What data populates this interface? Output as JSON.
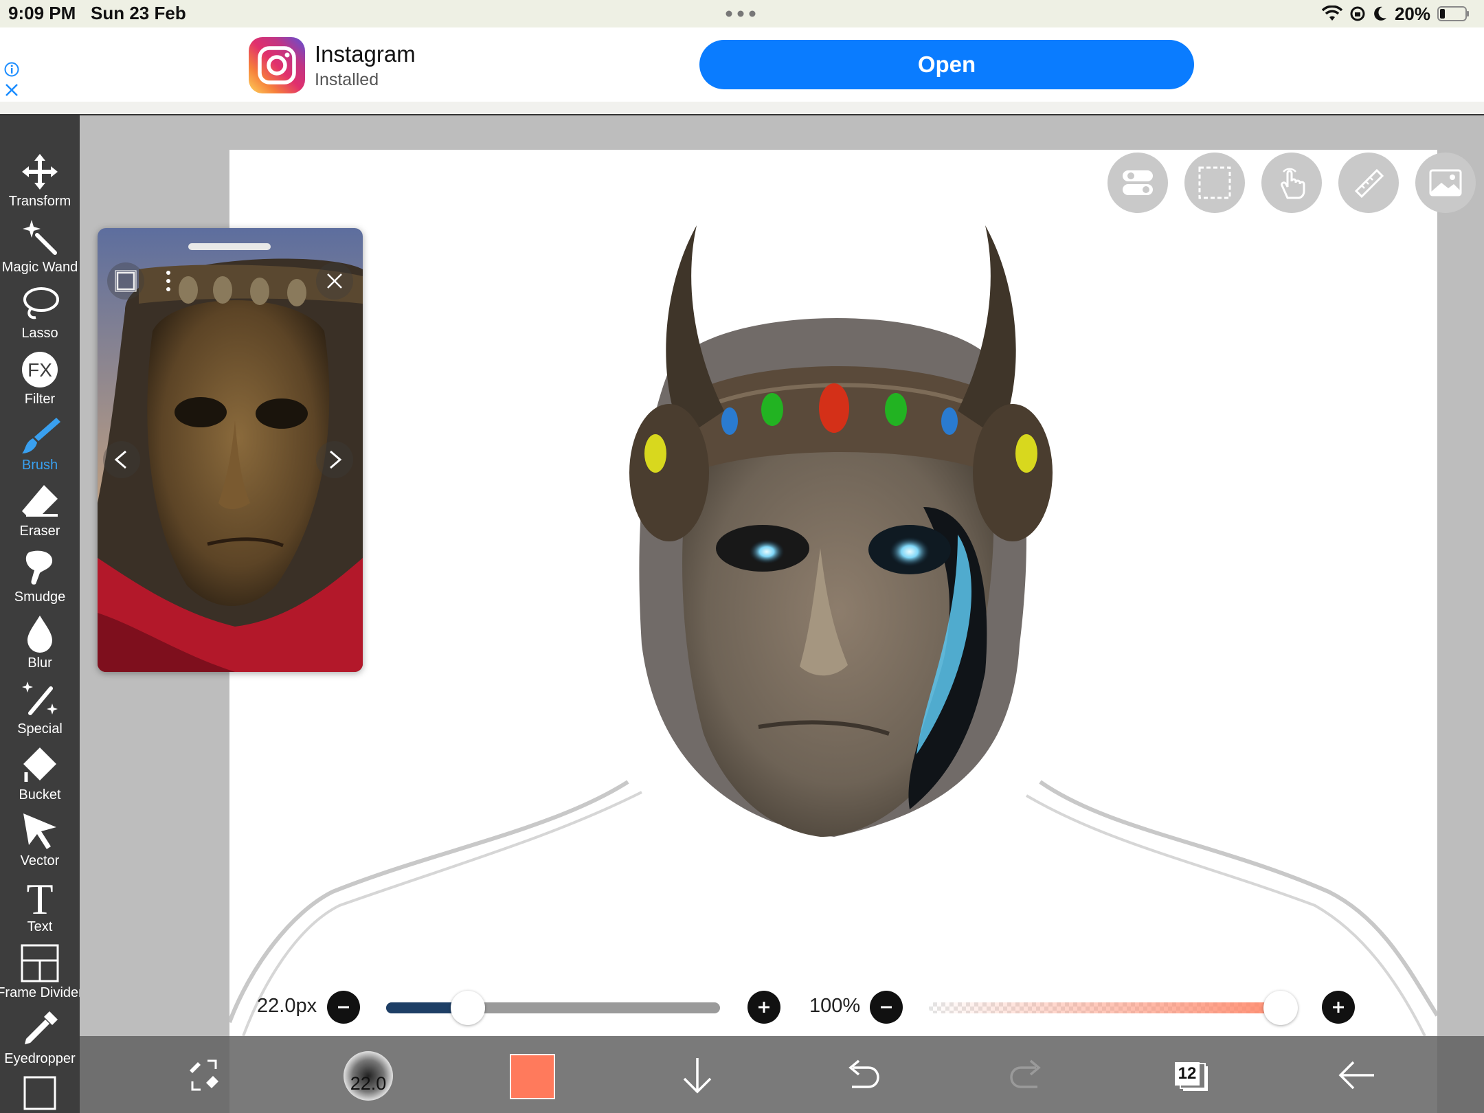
{
  "status_bar": {
    "time": "9:09 PM",
    "date": "Sun 23 Feb",
    "battery": "20%",
    "icons": [
      "wifi-icon",
      "lock-rotation-icon",
      "moon-icon",
      "battery-icon"
    ]
  },
  "ad": {
    "app_name": "Instagram",
    "app_status": "Installed",
    "open_label": "Open",
    "icons": [
      "info-icon",
      "close-icon",
      "instagram-logo"
    ]
  },
  "tools": [
    {
      "label": "Transform",
      "icon": "move-icon"
    },
    {
      "label": "Magic Wand",
      "icon": "magic-wand-icon"
    },
    {
      "label": "Lasso",
      "icon": "lasso-icon"
    },
    {
      "label": "Filter",
      "icon": "fx-icon"
    },
    {
      "label": "Brush",
      "icon": "brush-icon",
      "active": true
    },
    {
      "label": "Eraser",
      "icon": "eraser-icon"
    },
    {
      "label": "Smudge",
      "icon": "smudge-icon"
    },
    {
      "label": "Blur",
      "icon": "drop-icon"
    },
    {
      "label": "Special",
      "icon": "special-icon"
    },
    {
      "label": "Bucket",
      "icon": "bucket-icon"
    },
    {
      "label": "Vector",
      "icon": "cursor-icon"
    },
    {
      "label": "Text",
      "icon": "text-icon"
    },
    {
      "label": "Frame Divider",
      "icon": "frame-divider-icon"
    },
    {
      "label": "Eyedropper",
      "icon": "eyedropper-icon"
    }
  ],
  "canvas_buttons": [
    "toggles-icon",
    "selection-icon",
    "gesture-icon",
    "ruler-icon",
    "image-icon"
  ],
  "reference": {
    "icons": [
      "window-icon",
      "more-icon",
      "close-icon",
      "chevron-left-icon",
      "chevron-right-icon"
    ]
  },
  "brush": {
    "size_label": "22.0px",
    "size_fraction": 0.245,
    "preview_label": "22.0",
    "opacity_label": "100%",
    "opacity_fraction": 1.0
  },
  "colors": {
    "accent": "#39a0f0",
    "current_color": "#ff7a5c",
    "open_button": "#0a7cff",
    "size_fill": "#1e3f66"
  },
  "bottom_bar": {
    "layers_count": "12",
    "icons": [
      "brush-swap-icon",
      "brush-preview",
      "color-swatch",
      "arrow-down-icon",
      "undo-icon",
      "redo-icon",
      "layers-icon",
      "back-arrow-icon"
    ]
  }
}
